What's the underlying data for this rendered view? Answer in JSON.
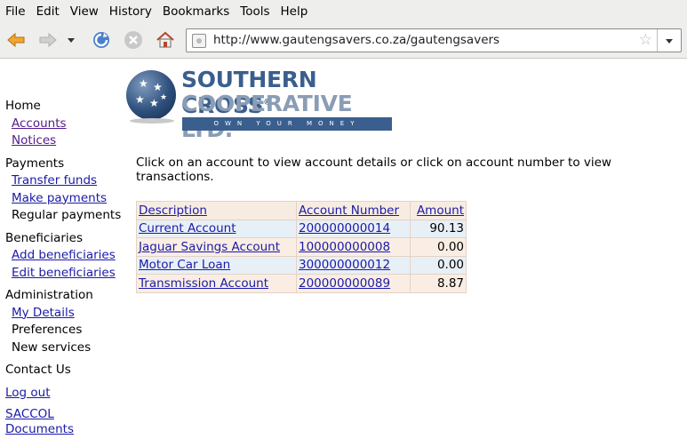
{
  "menubar": {
    "items": [
      "File",
      "Edit",
      "View",
      "History",
      "Bookmarks",
      "Tools",
      "Help"
    ]
  },
  "toolbar": {
    "url": "http://www.gautengsavers.co.za/gautengsavers"
  },
  "logo": {
    "line1": "SOUTHERN CROSS",
    "registered": "®",
    "line2": "COOPERATIVE LTD.",
    "tagline": "OWN YOUR MONEY"
  },
  "sidebar": {
    "home": "Home",
    "accounts": "Accounts",
    "notices": "Notices",
    "payments": "Payments",
    "transfer_funds": "Transfer funds",
    "make_payments": "Make payments",
    "regular_payments": "Regular payments",
    "beneficiaries": "Beneficiaries",
    "add_beneficiaries": "Add beneficiaries",
    "edit_beneficiaries": "Edit beneficiaries",
    "administration": "Administration",
    "my_details": "My Details",
    "preferences": "Preferences",
    "new_services": "New services",
    "contact_us": "Contact Us",
    "log_out": "Log out",
    "saccol": "SACCOL",
    "documents": "Documents"
  },
  "main": {
    "intro": "Click on an account to view account details or click on account number to view transactions.",
    "table": {
      "headers": [
        "Description",
        "Account Number",
        "Amount"
      ],
      "rows": [
        {
          "description": "Current Account",
          "number": "200000000014",
          "amount": "90.13"
        },
        {
          "description": "Jaguar Savings Account",
          "number": "100000000008",
          "amount": "0.00"
        },
        {
          "description": "Motor Car Loan",
          "number": "300000000012",
          "amount": "0.00"
        },
        {
          "description": "Transmission Account",
          "number": "200000000089",
          "amount": "8.87"
        }
      ]
    }
  },
  "colors": {
    "link": "#1a1aa8",
    "visited": "#551a8b",
    "logo_blue": "#3a5f8e",
    "logo_grey": "#8a9db5"
  }
}
